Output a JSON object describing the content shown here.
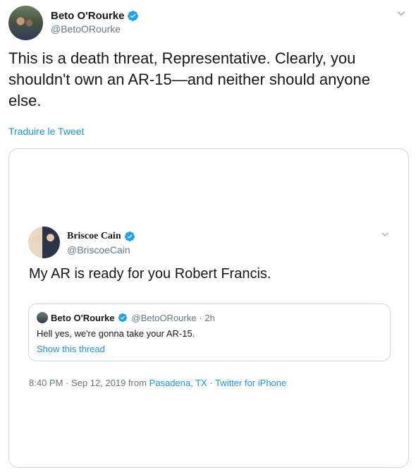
{
  "tweet": {
    "author_name": "Beto O'Rourke",
    "author_handle": "@BetoORourke",
    "text": "This is a death threat, Representative. Clearly, you shouldn't own an AR-15—and neither should anyone else.",
    "translate_label": "Traduire le Tweet"
  },
  "embedded": {
    "author_name": "Briscoe Cain",
    "author_handle": "@BriscoeCain",
    "text": "My AR is ready for you Robert Francis.",
    "quoted": {
      "author_name": "Beto O'Rourke",
      "author_handle": "@BetoORourke",
      "time": "· 2h",
      "text": "Hell yes, we're gonna take your AR-15.",
      "show_thread": "Show this thread"
    },
    "meta": {
      "timestamp": "8:40 PM · Sep 12, 2019 from",
      "location": "Pasadena, TX",
      "separator": "·",
      "source": "Twitter for iPhone"
    }
  },
  "colors": {
    "link": "#1b95e0",
    "verified": "#1da1f2",
    "secondary_text": "#657786",
    "border": "#ccd6dd"
  },
  "icons": {
    "verified": "verified-badge-icon",
    "caret": "chevron-down-icon"
  }
}
